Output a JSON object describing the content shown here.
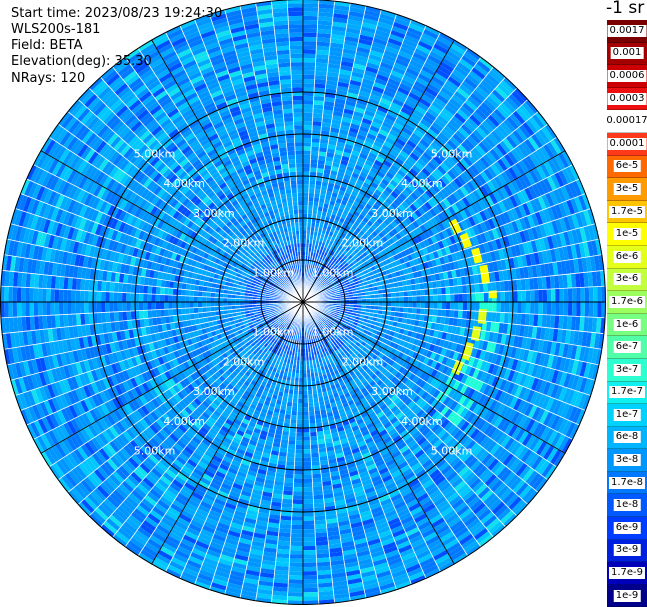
{
  "info": {
    "start_time": "Start time: 2023/08/23 19:24:30",
    "instrument": "WLS200s-181",
    "field": "Field: BETA",
    "elevation": "Elevation(deg): 35.30",
    "nrays": "NRays: 120"
  },
  "unit_label": "-1 sr",
  "range_rings": {
    "labels": [
      "1.00km",
      "2.00km",
      "3.00km",
      "4.00km",
      "5.00km"
    ]
  },
  "legend": {
    "entries": [
      {
        "label": "0.0017",
        "color": "#7a0000"
      },
      {
        "label": "0.001",
        "color": "#a50000"
      },
      {
        "label": "0.0006",
        "color": "#cc0000"
      },
      {
        "label": "0.0003",
        "color": "#ee1010"
      },
      {
        "label": "0.00017",
        "color": "#ffffff"
      },
      {
        "label": "0.0001",
        "color": "#ff3a1a"
      },
      {
        "label": "6e-5",
        "color": "#ff6a00"
      },
      {
        "label": "3e-5",
        "color": "#ff9a00"
      },
      {
        "label": "1.7e-5",
        "color": "#ffc400"
      },
      {
        "label": "1e-5",
        "color": "#ffff00"
      },
      {
        "label": "6e-6",
        "color": "#e4ff1a"
      },
      {
        "label": "3e-6",
        "color": "#c2ff3c"
      },
      {
        "label": "1.7e-6",
        "color": "#9cff60"
      },
      {
        "label": "1e-6",
        "color": "#76ff80"
      },
      {
        "label": "6e-7",
        "color": "#50ffa8"
      },
      {
        "label": "3e-7",
        "color": "#2cffd0"
      },
      {
        "label": "1.7e-7",
        "color": "#10f0f0"
      },
      {
        "label": "1e-7",
        "color": "#00d2ff"
      },
      {
        "label": "6e-8",
        "color": "#00b4ff"
      },
      {
        "label": "3e-8",
        "color": "#0096ff"
      },
      {
        "label": "1.7e-8",
        "color": "#0078ff"
      },
      {
        "label": "1e-8",
        "color": "#005aff"
      },
      {
        "label": "6e-9",
        "color": "#003cff"
      },
      {
        "label": "3e-9",
        "color": "#0020e0"
      },
      {
        "label": "1.7e-9",
        "color": "#0000b8"
      },
      {
        "label": "1e-9",
        "color": "#00008b"
      }
    ]
  },
  "colors": {
    "ring_color": "#000000",
    "spoke_color": "#ffffff",
    "field_palette": [
      "#0050ff",
      "#0078ff",
      "#0096ff",
      "#00aaff",
      "#00c8ff",
      "#10e0f0"
    ]
  }
}
